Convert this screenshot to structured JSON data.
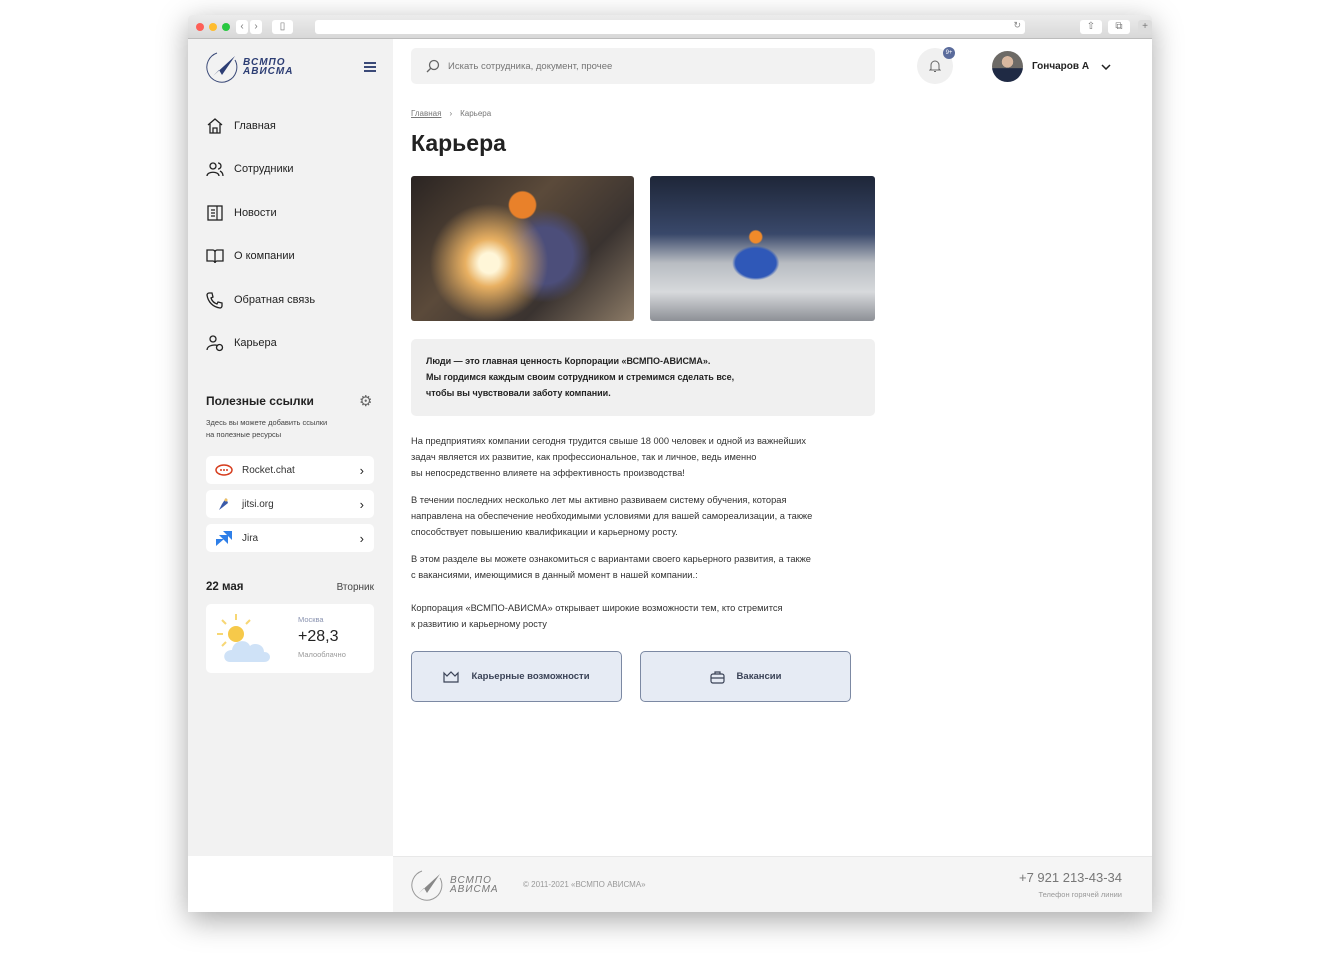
{
  "browser": {
    "colors": {
      "close": "#fe5f57",
      "min": "#febc2e",
      "max": "#28c840"
    }
  },
  "logo": {
    "line1": "ВСМПО",
    "line2": "АВИСМА"
  },
  "search": {
    "placeholder": "Искать сотрудника, документ, прочее"
  },
  "notifications": {
    "badge": "9+"
  },
  "user": {
    "name": "Гончаров А"
  },
  "sidebar": {
    "items": [
      {
        "label": "Главная",
        "icon": "home-icon"
      },
      {
        "label": "Сотрудники",
        "icon": "users-icon"
      },
      {
        "label": "Новости",
        "icon": "news-icon"
      },
      {
        "label": "О компании",
        "icon": "book-icon"
      },
      {
        "label": "Обратная связь",
        "icon": "phone-icon"
      },
      {
        "label": "Карьера",
        "icon": "career-icon"
      }
    ]
  },
  "useful_links": {
    "title": "Полезные ссылки",
    "desc1": "Здесь вы можете добавить ссылки",
    "desc2": "на полезные ресурсы",
    "links": [
      {
        "label": "Rocket.chat"
      },
      {
        "label": "jitsi.org"
      },
      {
        "label": "Jira"
      }
    ]
  },
  "date": {
    "day": "22 мая",
    "weekday": "Вторник"
  },
  "weather": {
    "city": "Москва",
    "temp": "+28,3",
    "desc": "Малооблачно"
  },
  "breadcrumb": {
    "home": "Главная",
    "current": "Карьера"
  },
  "page": {
    "title": "Карьера",
    "quote": [
      "Люди — это главная ценность Корпорации «ВСМПО-АВИСМА».",
      "Мы гордимся каждым своим сотрудником и стремимся сделать все,",
      "чтобы вы чувствовали заботу компании."
    ],
    "p1": [
      "На предприятиях компании сегодня трудится свыше 18 000 человек и одной из важнейших",
      "задач является их развитие, как профессиональное, так и личное, ведь именно",
      "вы непосредственно влияете на эффективность производства!"
    ],
    "p2": [
      "В течении последних несколько лет мы активно развиваем систему обучения, которая",
      "направлена на обеспечение необходимыми условиями для вашей самореализации, а также",
      "способствует повышению квалификации и карьерному росту."
    ],
    "p3": [
      "В этом разделе вы можете ознакомиться с вариантами своего карьерного развития, а также",
      "с вакансиями, имеющимися в данный момент в нашей компании.:"
    ],
    "p4": [
      "Корпорация «ВСМПО-АВИСМА» открывает широкие возможности тем, кто стремится",
      "к развитию и карьерному росту"
    ],
    "btn_career": "Карьерные возможности",
    "btn_vacancies": "Вакансии"
  },
  "footer": {
    "copyright": "© 2011-2021 «ВСМПО АВИСМА»",
    "phone": "+7 921 213-43-34",
    "phone_label": "Телефон горячей линии"
  }
}
